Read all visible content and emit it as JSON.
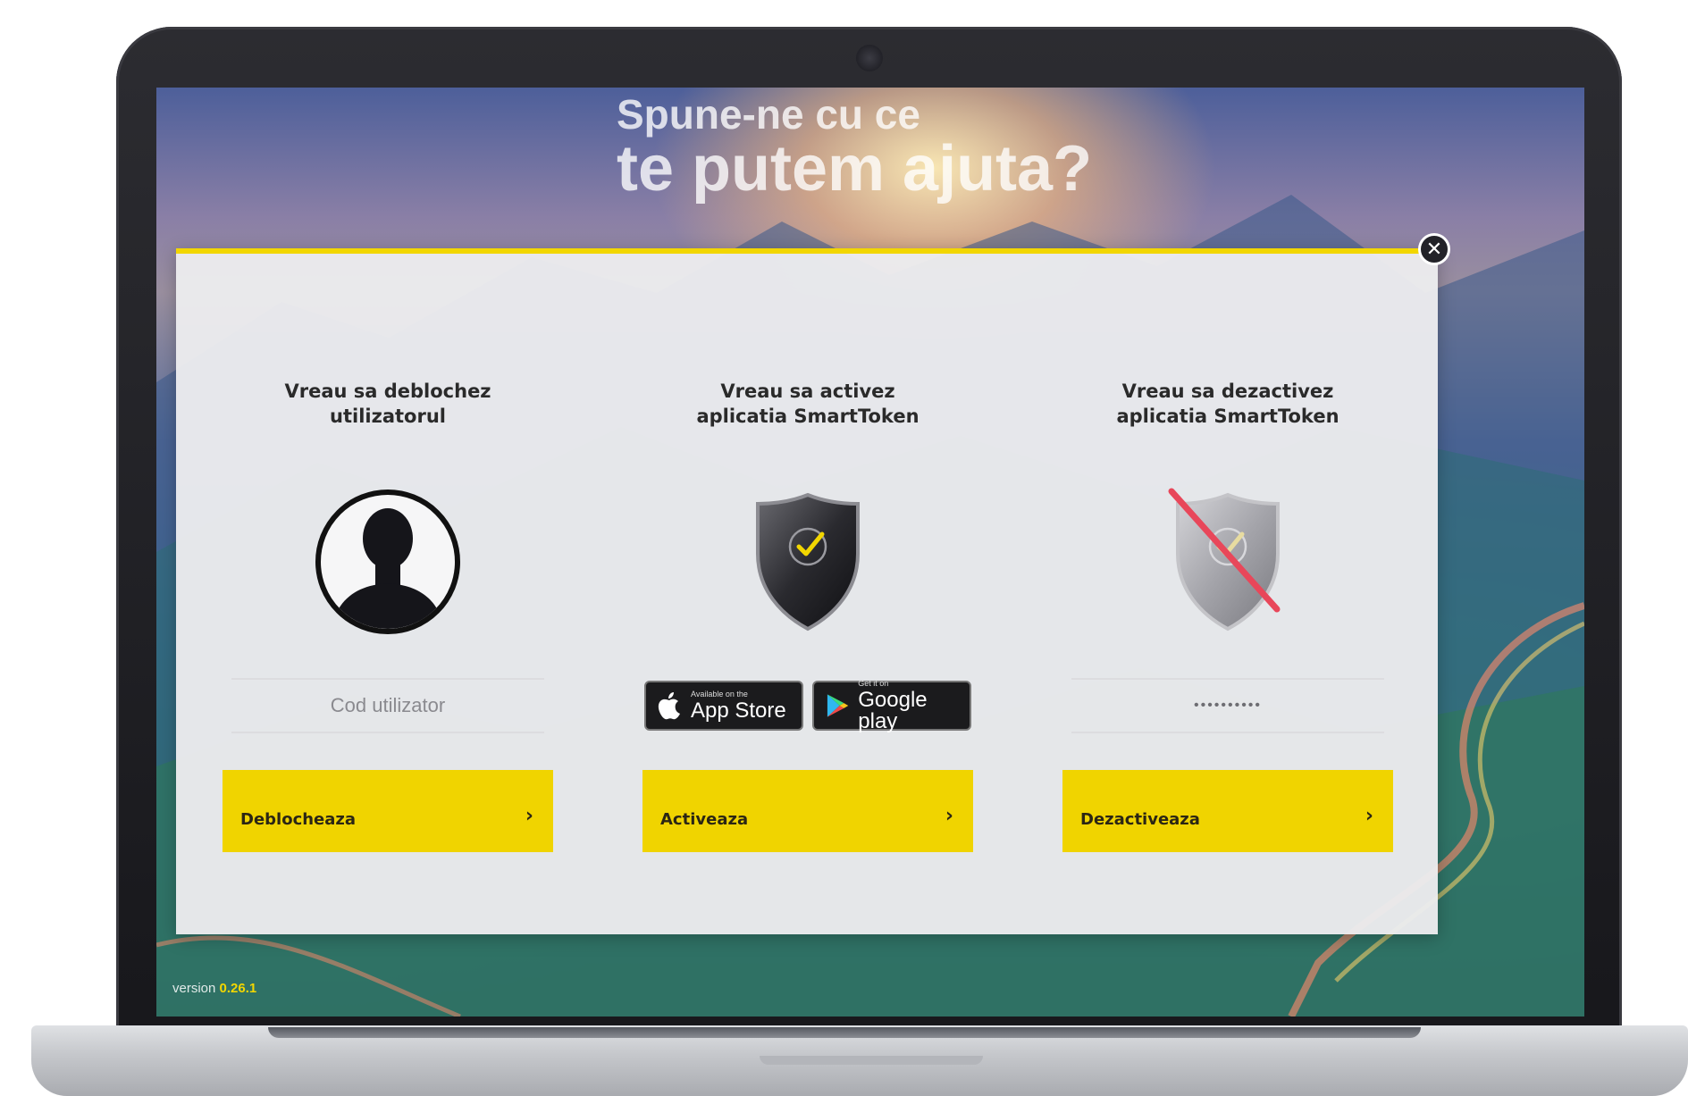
{
  "hero": {
    "line1": "Spune-ne cu ce",
    "line2": "te putem ajuta?"
  },
  "modal": {
    "close_icon": "close-icon",
    "accent_color": "#f2d600",
    "columns": [
      {
        "heading_line1": "Vreau sa deblochez",
        "heading_line2": "utilizatorul",
        "icon": "user-silhouette-icon",
        "field_placeholder": "Cod utilizator",
        "button_label": "Deblocheaza",
        "button_chevron": "›"
      },
      {
        "heading_line1": "Vreau sa activez",
        "heading_line2": "aplicatia SmartToken",
        "icon": "shield-check-icon",
        "app_store": {
          "small": "Available on the",
          "big": "App Store",
          "icon": "apple-icon"
        },
        "google_play": {
          "small": "Get it on",
          "big": "Google play",
          "icon": "google-play-icon"
        },
        "button_label": "Activeaza",
        "button_chevron": "›"
      },
      {
        "heading_line1": "Vreau sa dezactivez",
        "heading_line2": "aplicatia SmartToken",
        "icon": "shield-disabled-icon",
        "field_value": "••••••••••",
        "button_label": "Dezactiveaza",
        "button_chevron": "›"
      }
    ]
  },
  "footer": {
    "version_label": "version",
    "version_number": "0.26.1"
  }
}
